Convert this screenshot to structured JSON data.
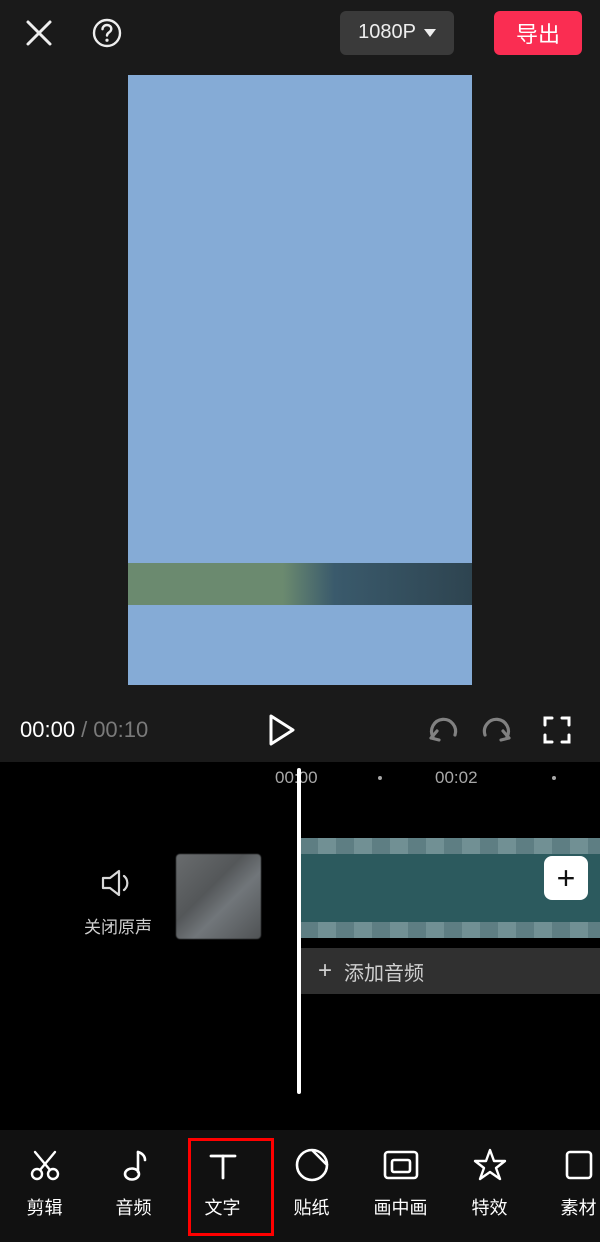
{
  "topbar": {
    "resolution_label": "1080P",
    "export_label": "导出"
  },
  "player": {
    "current_time": "00:00",
    "time_separator": "/",
    "total_time": "00:10"
  },
  "timeline": {
    "ruler": {
      "tick0": "00:00",
      "tick1": "00:02"
    },
    "mute_label": "关闭原声",
    "add_audio_label": "添加音频"
  },
  "toolbar": {
    "items": [
      {
        "key": "cut",
        "label": "剪辑"
      },
      {
        "key": "audio",
        "label": "音频"
      },
      {
        "key": "text",
        "label": "文字"
      },
      {
        "key": "sticker",
        "label": "贴纸"
      },
      {
        "key": "pip",
        "label": "画中画"
      },
      {
        "key": "effect",
        "label": "特效"
      },
      {
        "key": "material",
        "label": "素材"
      }
    ],
    "highlighted_index": 2
  }
}
